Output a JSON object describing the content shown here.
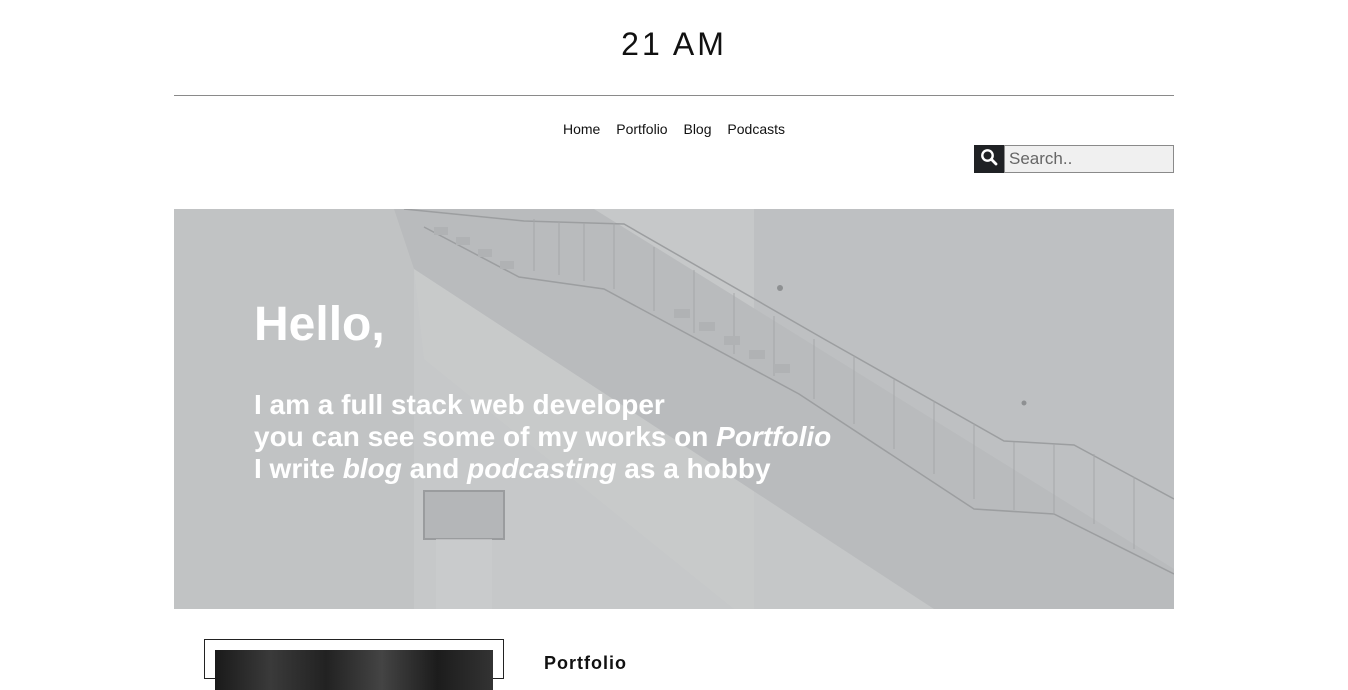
{
  "site": {
    "title": "21 AM"
  },
  "nav": {
    "items": [
      {
        "label": "Home"
      },
      {
        "label": "Portfolio"
      },
      {
        "label": "Blog"
      },
      {
        "label": "Podcasts"
      }
    ]
  },
  "search": {
    "icon": "search-icon",
    "placeholder": "Search..",
    "value": ""
  },
  "hero": {
    "title": "Hello,",
    "line1": "I am a full stack web developer",
    "line2_prefix": "you can see some of my works on ",
    "line2_link": "Portfolio",
    "line3_prefix": "I write ",
    "line3_blog": "blog",
    "line3_mid": " and ",
    "line3_podcast": "podcasting",
    "line3_suffix": " as a hobby"
  },
  "sections": {
    "portfolio_heading": "Portfolio"
  },
  "colors": {
    "hero_overlay": "#c3c5c6",
    "search_button": "#1f2124",
    "text": "#111111"
  }
}
